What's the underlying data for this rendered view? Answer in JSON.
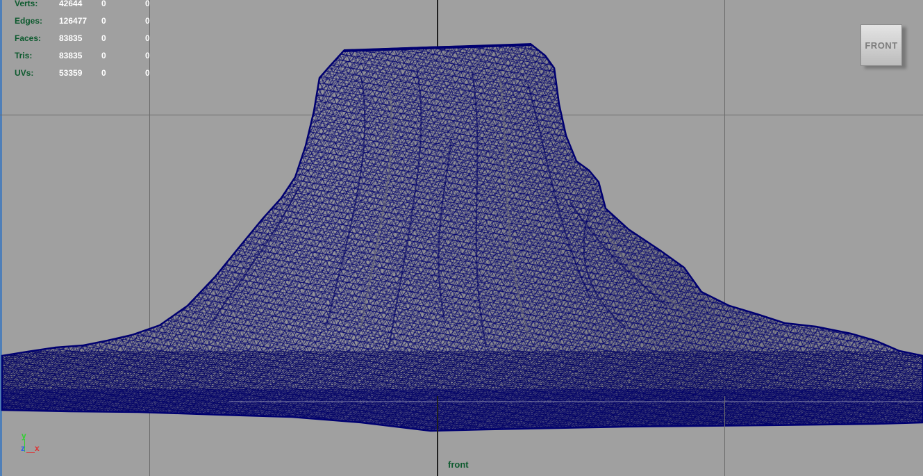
{
  "hud": {
    "rows": [
      {
        "label": "Verts:",
        "values": [
          "42644",
          "0",
          "0"
        ]
      },
      {
        "label": "Edges:",
        "values": [
          "126477",
          "0",
          "0"
        ]
      },
      {
        "label": "Faces:",
        "values": [
          "83835",
          "0",
          "0"
        ]
      },
      {
        "label": "Tris:",
        "values": [
          "83835",
          "0",
          "0"
        ]
      },
      {
        "label": "UVs:",
        "values": [
          "53359",
          "0",
          "0"
        ]
      }
    ]
  },
  "viewcube": {
    "label": "FRONT"
  },
  "axis_gizmo": {
    "y": "y",
    "z": "z",
    "x": "x"
  },
  "camera": {
    "name": "front"
  },
  "colors": {
    "background": "#a0a0a0",
    "wireframe": "#00006e",
    "mesh_fill": "#8a8a92",
    "hud_label": "#0d5a2e",
    "hud_value": "#ffffff"
  }
}
